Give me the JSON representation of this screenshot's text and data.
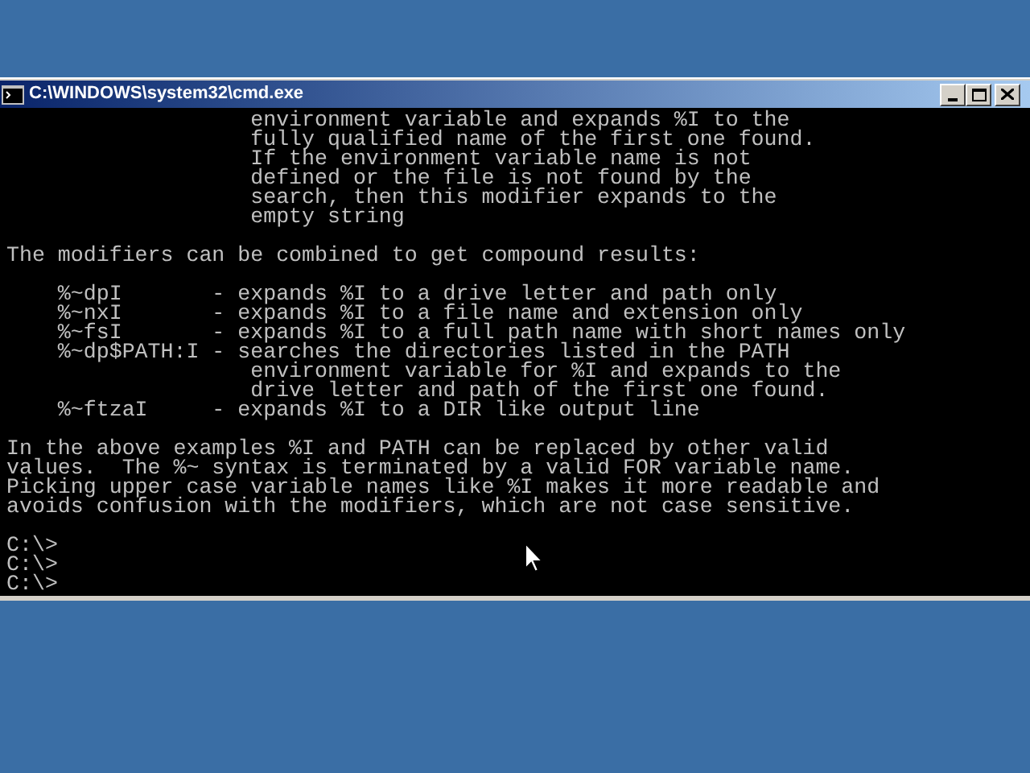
{
  "window": {
    "title": "C:\\WINDOWS\\system32\\cmd.exe"
  },
  "console": {
    "blocks": [
      {
        "lines": [
          "                   environment variable and expands %I to the",
          "                   fully qualified name of the first one found.",
          "                   If the environment variable name is not",
          "                   defined or the file is not found by the",
          "                   search, then this modifier expands to the",
          "                   empty string"
        ]
      },
      {
        "lines": [
          "The modifiers can be combined to get compound results:"
        ]
      },
      {
        "lines": [
          "    %~dpI       - expands %I to a drive letter and path only",
          "    %~nxI       - expands %I to a file name and extension only",
          "    %~fsI       - expands %I to a full path name with short names only",
          "    %~dp$PATH:I - searches the directories listed in the PATH",
          "                   environment variable for %I and expands to the",
          "                   drive letter and path of the first one found.",
          "    %~ftzaI     - expands %I to a DIR like output line"
        ]
      },
      {
        "lines": [
          "In the above examples %I and PATH can be replaced by other valid",
          "values.  The %~ syntax is terminated by a valid FOR variable name.",
          "Picking upper case variable names like %I makes it more readable and",
          "avoids confusion with the modifiers, which are not case sensitive."
        ]
      },
      {
        "lines": [
          "C:\\>",
          "C:\\>",
          "C:\\>"
        ]
      }
    ]
  }
}
